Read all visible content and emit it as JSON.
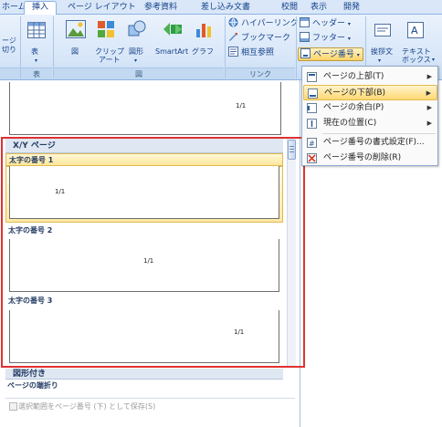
{
  "tabs": [
    "ホーム",
    "挿入",
    "ページ レイアウト",
    "参考資料",
    "差し込み文書",
    "校閲",
    "表示",
    "開発"
  ],
  "ribbon": {
    "page_group_partial_top": "ージ",
    "page_group_partial_bottom": "切り",
    "table_label": "表",
    "table_group": "表",
    "figure_group": "図",
    "figure_buttons": [
      "図",
      "クリップ\nアート",
      "図形",
      "SmartArt",
      "グラフ"
    ],
    "clip_label_1": "クリップ",
    "clip_label_2": "アート",
    "link_group": "リンク",
    "link_buttons": [
      "ハイパーリンク",
      "ブックマーク",
      "相互参照"
    ],
    "header_footer_buttons": [
      "ヘッダー",
      "フッター",
      "ページ番号"
    ],
    "text_buttons": [
      "挨拶文",
      "テキスト\nボックス"
    ],
    "textbox_label_1": "テキスト",
    "textbox_label_2": "ボックス"
  },
  "gallery": {
    "top_preview_number": "1/1",
    "section_header": "X/Y ページ",
    "items": [
      {
        "title": "太字の番号 1",
        "number": "1/1",
        "align": "left"
      },
      {
        "title": "太字の番号 2",
        "number": "1/1",
        "align": "center"
      },
      {
        "title": "太字の番号 3",
        "number": "1/1",
        "align": "right"
      }
    ],
    "bottom_items": [
      "図形付き",
      "ページの端折り"
    ],
    "save_selection": "選択範囲をページ番号 (下) として保存(S)"
  },
  "menu": {
    "items": [
      {
        "label": "ページの上部(T)",
        "submenu": true
      },
      {
        "label": "ページの下部(B)",
        "submenu": true,
        "highlighted": true
      },
      {
        "label": "ページの余白(P)",
        "submenu": true
      },
      {
        "label": "現在の位置(C)",
        "submenu": true
      },
      {
        "label": "ページ番号の書式設定(F)...",
        "submenu": false
      },
      {
        "label": "ページ番号の削除(R)",
        "submenu": false
      }
    ]
  },
  "colors": {
    "accent": "#ffd872",
    "frame": "#e03131",
    "ribbon": "#d7e6f8"
  }
}
